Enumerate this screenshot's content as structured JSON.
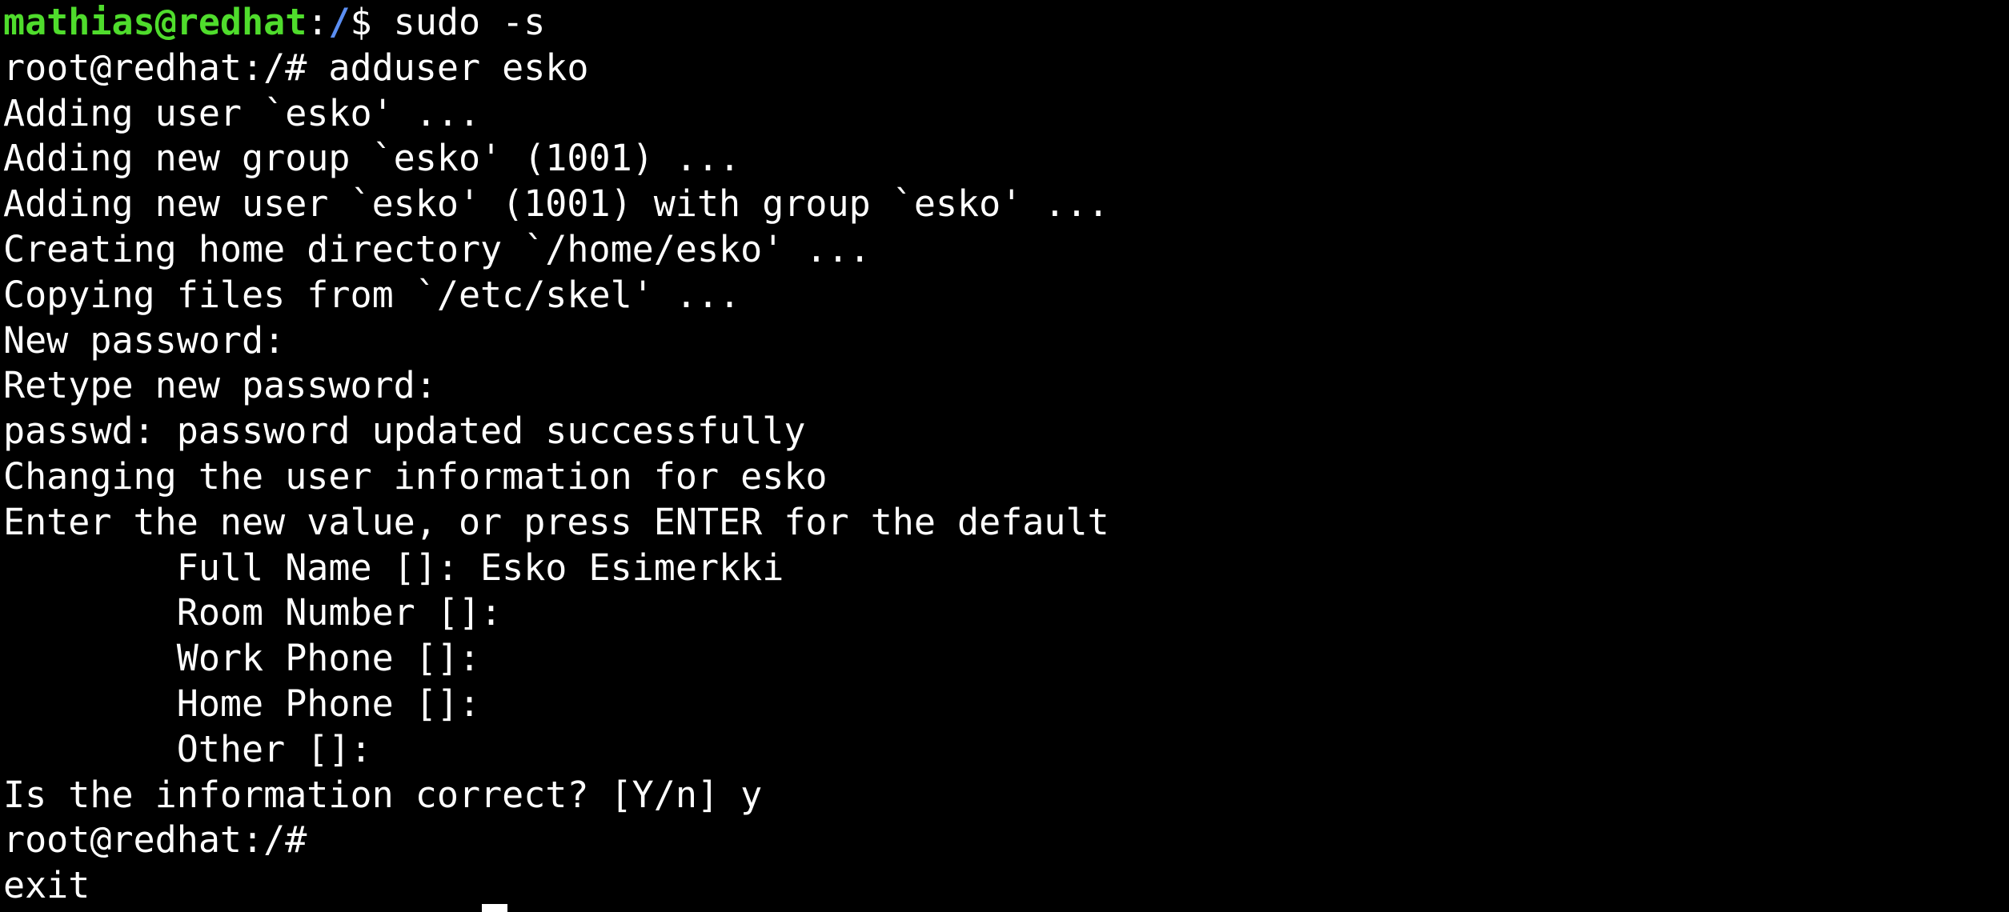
{
  "terminal": {
    "background": "#000000",
    "foreground": "#ffffff",
    "prompt_user_color": "#4fdc2c",
    "prompt_path_color": "#5b8ef2",
    "first_prompt": {
      "user_host": "mathias@redhat",
      "separator": ":",
      "path": "/",
      "symbol": "$ ",
      "command": "sudo -s"
    },
    "lines": [
      "root@redhat:/# adduser esko",
      "Adding user `esko' ...",
      "Adding new group `esko' (1001) ...",
      "Adding new user `esko' (1001) with group `esko' ...",
      "Creating home directory `/home/esko' ...",
      "Copying files from `/etc/skel' ...",
      "New password:",
      "Retype new password:",
      "passwd: password updated successfully",
      "Changing the user information for esko",
      "Enter the new value, or press ENTER for the default",
      "        Full Name []: Esko Esimerkki",
      "        Room Number []:",
      "        Work Phone []:",
      "        Home Phone []:",
      "        Other []:",
      "Is the information correct? [Y/n] y",
      "root@redhat:/#",
      "exit"
    ]
  }
}
